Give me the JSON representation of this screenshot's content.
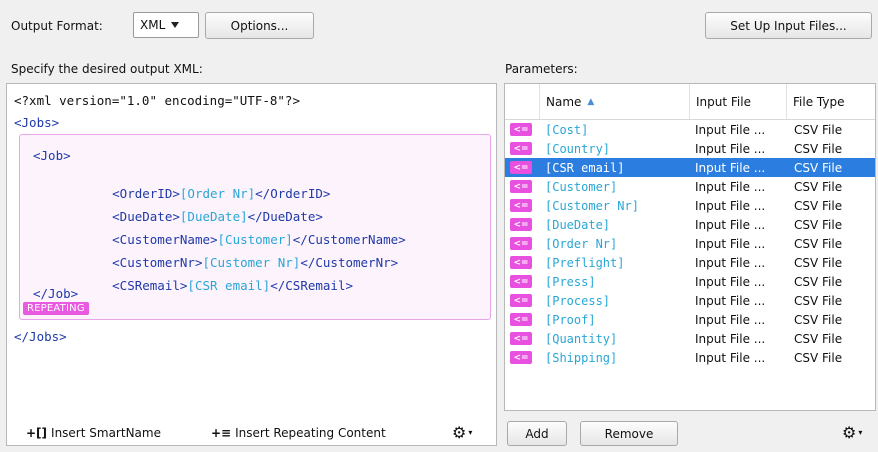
{
  "toolbar": {
    "output_format_label": "Output Format:",
    "output_format_value": "XML",
    "options_button": "Options...",
    "setup_button": "Set Up Input Files..."
  },
  "left": {
    "title": "Specify the desired output XML:",
    "xml_decl": "<?xml version=\"1.0\" encoding=\"UTF-8\"?>",
    "jobs_open": "<Jobs>",
    "job_open": "<Job>",
    "lines": [
      {
        "open": "<OrderID>",
        "var": "[Order Nr]",
        "close": "</OrderID>"
      },
      {
        "open": "<DueDate>",
        "var": "[DueDate]",
        "close": "</DueDate>"
      },
      {
        "open": "<CustomerName>",
        "var": "[Customer]",
        "close": "</CustomerName>"
      },
      {
        "open": "<CustomerNr>",
        "var": "[Customer Nr]",
        "close": "</CustomerNr>"
      },
      {
        "open": "<CSRemail>",
        "var": "[CSR email]",
        "close": "</CSRemail>"
      }
    ],
    "job_close": "</Job>",
    "repeating_badge": "REPEATING",
    "jobs_close": "</Jobs>",
    "insert_smartname": "Insert SmartName",
    "insert_repeating": "Insert Repeating Content"
  },
  "right": {
    "title": "Parameters:",
    "columns": {
      "name": "Name",
      "input_file": "Input File",
      "file_type": "File Type"
    },
    "rows": [
      {
        "name": "[Cost]",
        "input": "Input File ...",
        "type": "CSV File",
        "selected": false
      },
      {
        "name": "[Country]",
        "input": "Input File ...",
        "type": "CSV File",
        "selected": false
      },
      {
        "name": "[CSR email]",
        "input": "Input File ...",
        "type": "CSV File",
        "selected": true
      },
      {
        "name": "[Customer]",
        "input": "Input File ...",
        "type": "CSV File",
        "selected": false
      },
      {
        "name": "[Customer Nr]",
        "input": "Input File ...",
        "type": "CSV File",
        "selected": false
      },
      {
        "name": "[DueDate]",
        "input": "Input File ...",
        "type": "CSV File",
        "selected": false
      },
      {
        "name": "[Order Nr]",
        "input": "Input File ...",
        "type": "CSV File",
        "selected": false
      },
      {
        "name": "[Preflight]",
        "input": "Input File ...",
        "type": "CSV File",
        "selected": false
      },
      {
        "name": "[Press]",
        "input": "Input File ...",
        "type": "CSV File",
        "selected": false
      },
      {
        "name": "[Process]",
        "input": "Input File ...",
        "type": "CSV File",
        "selected": false
      },
      {
        "name": "[Proof]",
        "input": "Input File ...",
        "type": "CSV File",
        "selected": false
      },
      {
        "name": "[Quantity]",
        "input": "Input File ...",
        "type": "CSV File",
        "selected": false
      },
      {
        "name": "[Shipping]",
        "input": "Input File ...",
        "type": "CSV File",
        "selected": false
      }
    ],
    "pill_label": "<=",
    "add_button": "Add",
    "remove_button": "Remove"
  }
}
